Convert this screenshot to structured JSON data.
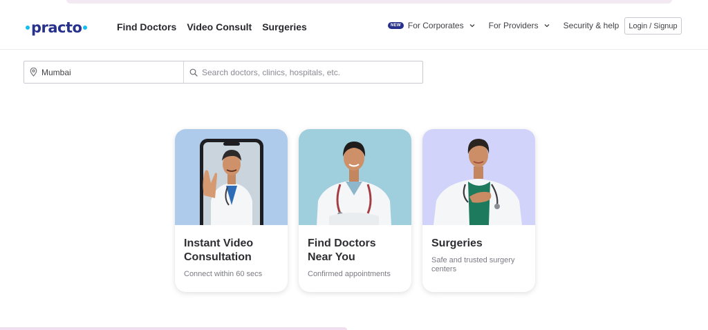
{
  "brand": {
    "logo_text": "practo",
    "logo_color": "#28328c",
    "dot_color": "#14bef0"
  },
  "nav": {
    "main": [
      "Find Doctors",
      "Video Consult",
      "Surgeries"
    ],
    "corporates": {
      "badge": "NEW",
      "label": "For Corporates"
    },
    "providers": "For Providers",
    "security": "Security & help",
    "login": "Login / Signup"
  },
  "search": {
    "location_value": "Mumbai",
    "query_placeholder": "Search doctors, clinics, hospitals, etc.",
    "location_icon": "location-pin-icon",
    "search_icon": "search-icon"
  },
  "cards": [
    {
      "title": "Instant Video Consultation",
      "subtitle": "Connect within 60 secs",
      "bg": "#aecbeb"
    },
    {
      "title": "Find Doctors Near You",
      "subtitle": "Confirmed appointments",
      "bg": "#9fcfdc"
    },
    {
      "title": "Surgeries",
      "subtitle": "Safe and trusted surgery centers",
      "bg": "#d2d3fa"
    }
  ]
}
